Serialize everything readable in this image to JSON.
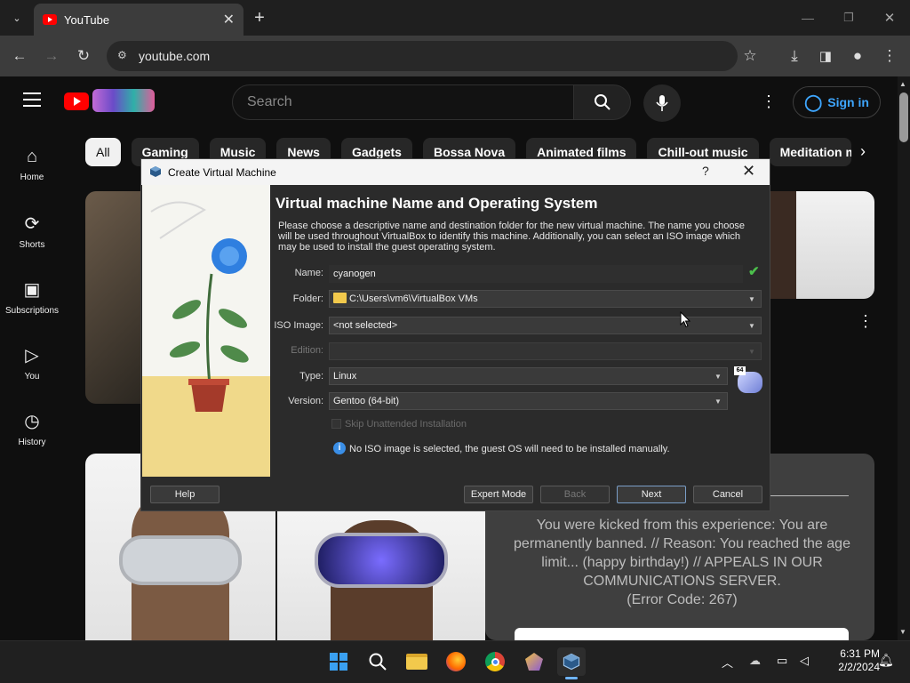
{
  "browser": {
    "tab_title": "YouTube",
    "url": "youtube.com"
  },
  "youtube": {
    "search_placeholder": "Search",
    "sign_in": "Sign in",
    "chips": [
      "All",
      "Gaming",
      "Music",
      "News",
      "Gadgets",
      "Bossa Nova",
      "Animated films",
      "Chill-out music",
      "Meditation mu"
    ],
    "nav": [
      {
        "label": "Home",
        "icon": "home-icon"
      },
      {
        "label": "Shorts",
        "icon": "shorts-icon"
      },
      {
        "label": "Subscriptions",
        "icon": "subscriptions-icon"
      },
      {
        "label": "You",
        "icon": "you-icon"
      },
      {
        "label": "History",
        "icon": "history-icon"
      }
    ],
    "error_message": "You were kicked from this experience: You are permanently banned. // Reason: You reached the age limit... (happy birthday!) // APPEALS IN OUR COMMUNICATIONS SERVER.",
    "error_code": "(Error Code: 267)"
  },
  "dialog": {
    "title": "Create Virtual Machine",
    "help_glyph": "?",
    "heading": "Virtual machine Name and Operating System",
    "description": "Please choose a descriptive name and destination folder for the new virtual machine. The name you choose will be used throughout VirtualBox to identify this machine. Additionally, you can select an ISO image which may be used to install the guest operating system.",
    "labels": {
      "name": "Name:",
      "folder": "Folder:",
      "iso": "ISO Image:",
      "edition": "Edition:",
      "type": "Type:",
      "version": "Version:"
    },
    "values": {
      "name": "cyanogen",
      "folder": "C:\\Users\\vm6\\VirtualBox VMs",
      "iso": "<not selected>",
      "edition": "",
      "type": "Linux",
      "version": "Gentoo (64-bit)"
    },
    "skip_unattended": "Skip Unattended Installation",
    "info": "No ISO image is selected, the guest OS will need to be installed manually.",
    "badge_64": "64",
    "buttons": {
      "help": "Help",
      "expert": "Expert Mode",
      "back": "Back",
      "next": "Next",
      "cancel": "Cancel"
    }
  },
  "taskbar": {
    "time": "6:31 PM",
    "date": "2/2/2024"
  }
}
